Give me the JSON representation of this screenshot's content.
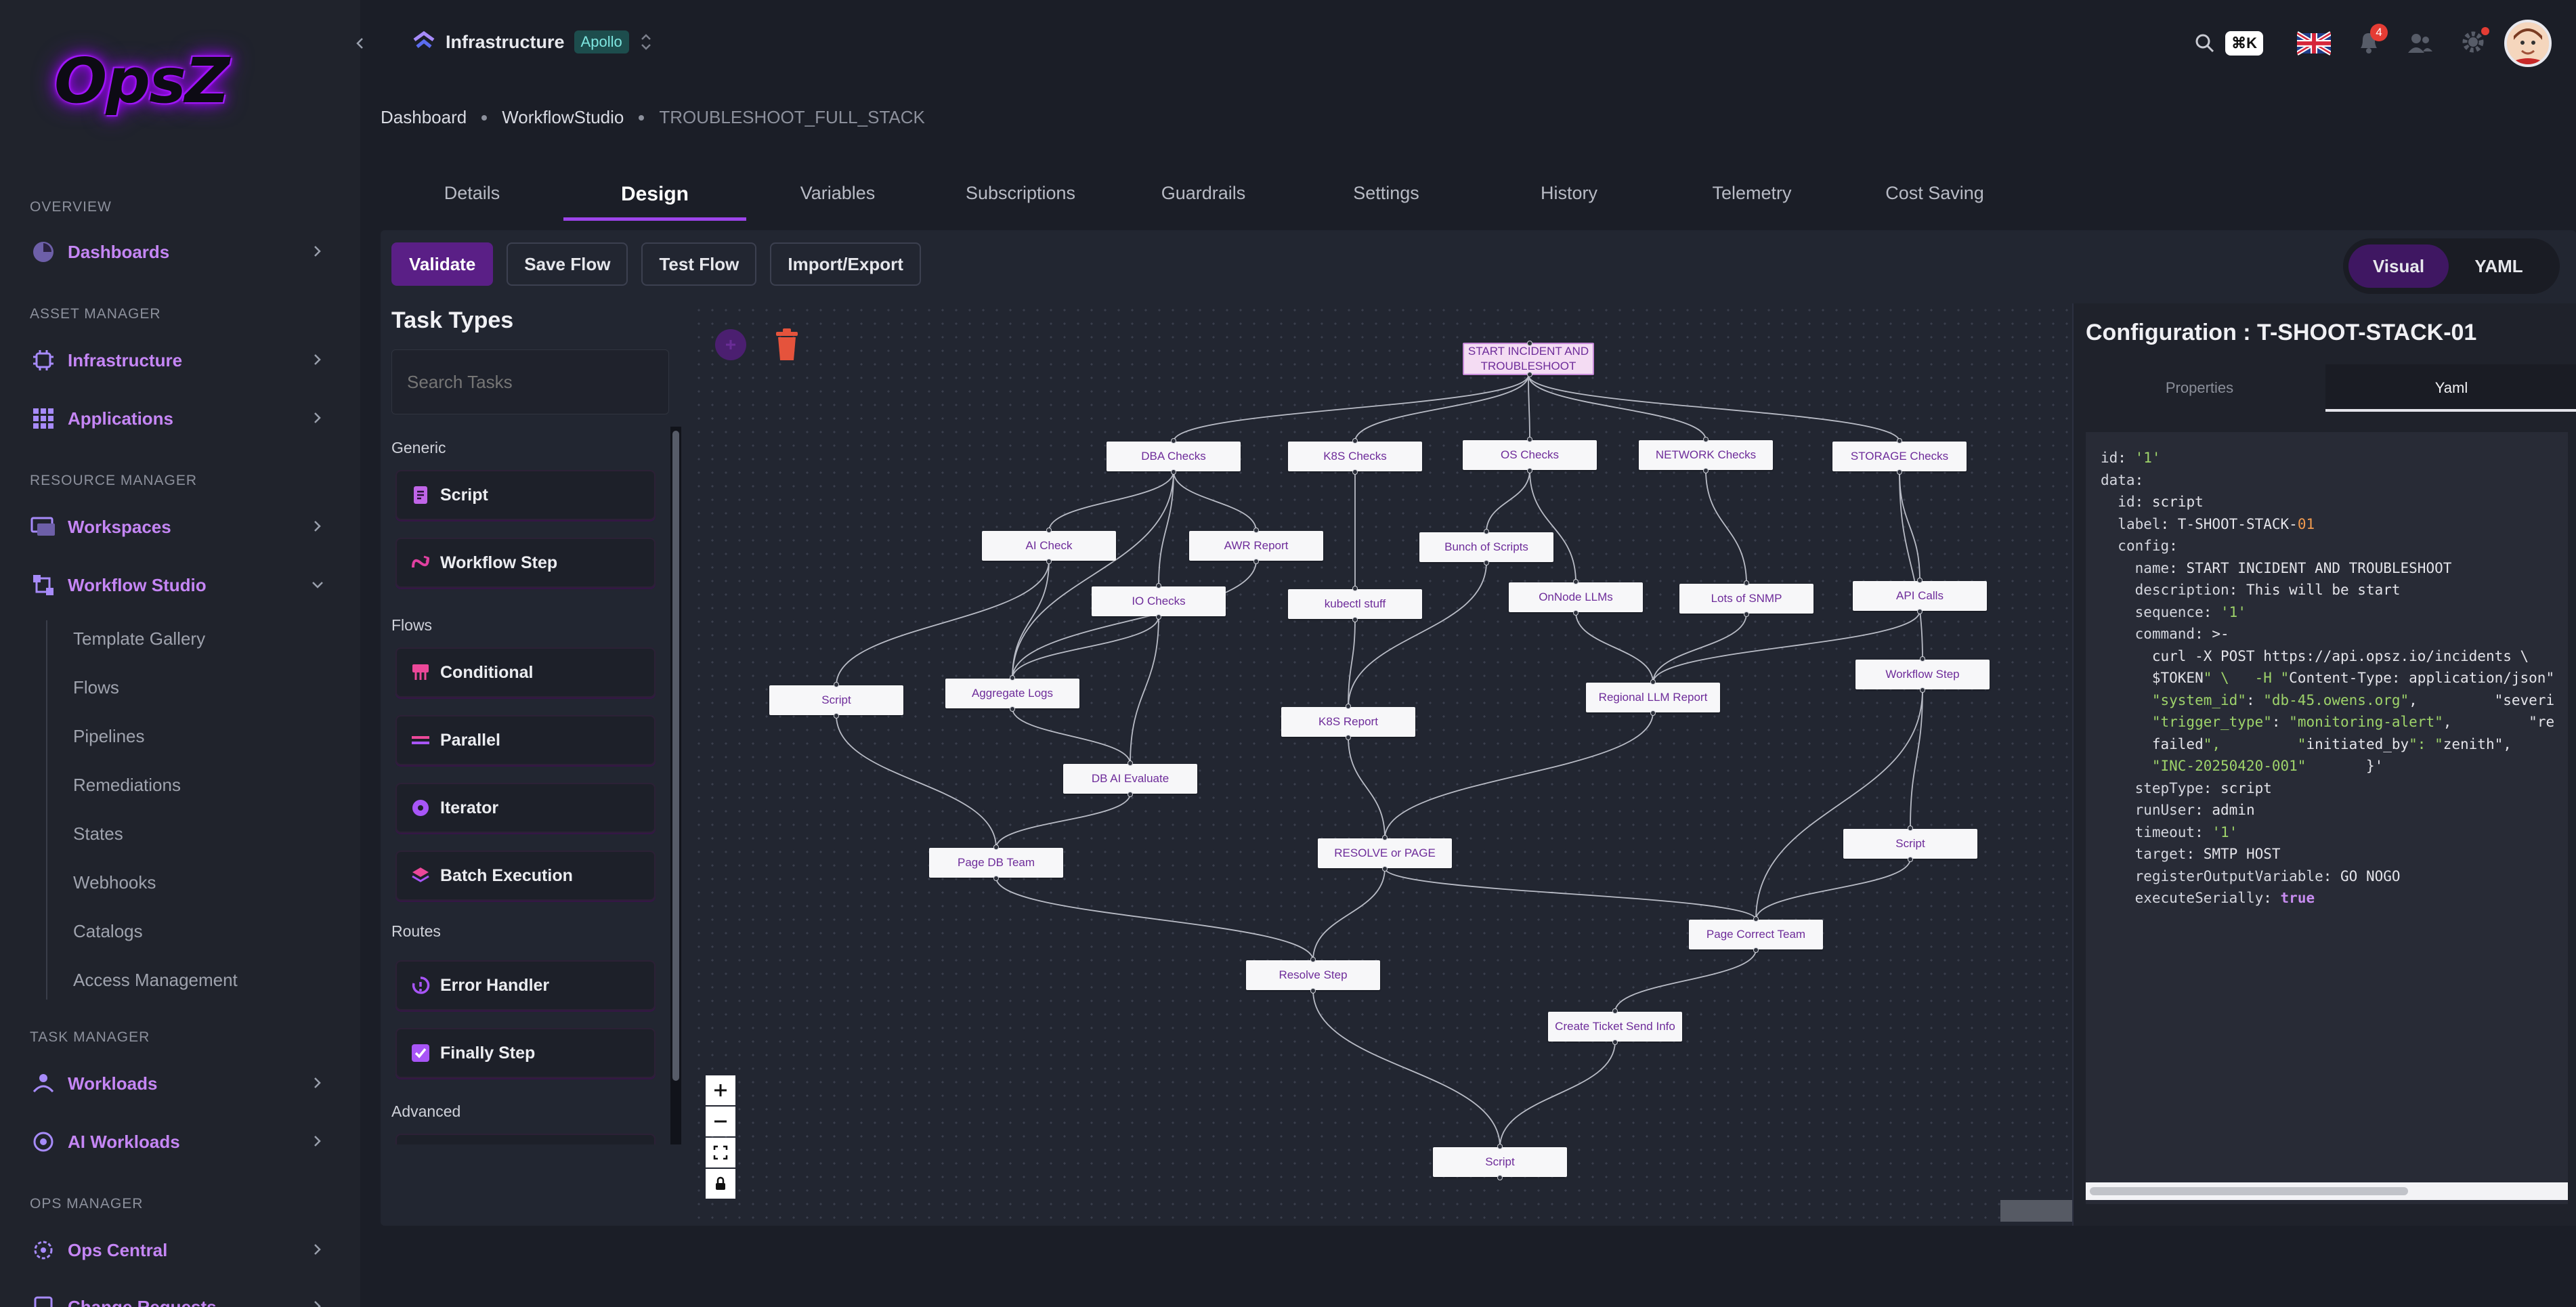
{
  "brand": {
    "logo_text": "OpsZ"
  },
  "sidebar": {
    "sections": [
      {
        "label": "OVERVIEW"
      },
      {
        "label": "ASSET MANAGER"
      },
      {
        "label": "RESOURCE MANAGER"
      },
      {
        "label": "TASK MANAGER"
      },
      {
        "label": "OPS MANAGER"
      }
    ],
    "items": [
      {
        "label": "Dashboards",
        "icon": "dashboard-icon"
      },
      {
        "label": "Infrastructure",
        "icon": "infrastructure-icon"
      },
      {
        "label": "Applications",
        "icon": "grid-icon"
      },
      {
        "label": "Workspaces",
        "icon": "workspaces-icon"
      },
      {
        "label": "Workflow Studio",
        "icon": "workflow-icon"
      },
      {
        "label": "Workloads",
        "icon": "workloads-icon"
      },
      {
        "label": "AI Workloads",
        "icon": "ai-workloads-icon"
      },
      {
        "label": "Ops Central",
        "icon": "ops-central-icon"
      },
      {
        "label": "Change Requests",
        "icon": "change-requests-icon"
      }
    ],
    "workflow_sub": [
      "Template Gallery",
      "Flows",
      "Pipelines",
      "Remediations",
      "States",
      "Webhooks",
      "Catalogs",
      "Access Management"
    ]
  },
  "topbar": {
    "workspace_name": "Infrastructure",
    "workspace_tag": "Apollo",
    "search_shortcut": "⌘K",
    "notification_count": "4"
  },
  "breadcrumb": {
    "items": [
      "Dashboard",
      "WorkflowStudio",
      "TROUBLESHOOT_FULL_STACK"
    ]
  },
  "tabs": [
    "Details",
    "Design",
    "Variables",
    "Subscriptions",
    "Guardrails",
    "Settings",
    "History",
    "Telemetry",
    "Cost Saving"
  ],
  "toolbar": {
    "validate": "Validate",
    "save_flow": "Save Flow",
    "test_flow": "Test Flow",
    "import_export": "Import/Export"
  },
  "view_toggle": {
    "visual": "Visual",
    "yaml": "YAML"
  },
  "task_types": {
    "title": "Task Types",
    "search_placeholder": "Search Tasks",
    "groups": [
      {
        "label": "Generic"
      },
      {
        "label": "Flows"
      },
      {
        "label": "Routes"
      },
      {
        "label": "Advanced"
      }
    ],
    "items": [
      {
        "label": "Script",
        "color": "#c065e8"
      },
      {
        "label": "Workflow Step",
        "color": "#e040a0"
      },
      {
        "label": "Conditional",
        "color": "#ec4899"
      },
      {
        "label": "Parallel",
        "color": "#ec4899"
      },
      {
        "label": "Iterator",
        "color": "#a855f7"
      },
      {
        "label": "Batch Execution",
        "color": "#ec4899"
      },
      {
        "label": "Error Handler",
        "color": "#a855f7"
      },
      {
        "label": "Finally Step",
        "color": "#a855f7"
      }
    ]
  },
  "flow": {
    "nodes": [
      {
        "id": "start",
        "label": "START INCIDENT AND TROUBLESHOOT"
      },
      {
        "id": "dba",
        "label": "DBA Checks"
      },
      {
        "id": "k8s",
        "label": "K8S Checks"
      },
      {
        "id": "os",
        "label": "OS Checks"
      },
      {
        "id": "net",
        "label": "NETWORK Checks"
      },
      {
        "id": "stor",
        "label": "STORAGE Checks"
      },
      {
        "id": "ai",
        "label": "AI Check"
      },
      {
        "id": "awr",
        "label": "AWR Report"
      },
      {
        "id": "bunch",
        "label": "Bunch of Scripts"
      },
      {
        "id": "io",
        "label": "IO Checks"
      },
      {
        "id": "kubectl",
        "label": "kubectl stuff"
      },
      {
        "id": "onnode",
        "label": "OnNode LLMs"
      },
      {
        "id": "snmp",
        "label": "Lots of SNMP"
      },
      {
        "id": "api",
        "label": "API Calls"
      },
      {
        "id": "script1",
        "label": "Script"
      },
      {
        "id": "agg",
        "label": "Aggregate Logs"
      },
      {
        "id": "wfstep",
        "label": "Workflow Step"
      },
      {
        "id": "k8srep",
        "label": "K8S Report"
      },
      {
        "id": "regional",
        "label": "Regional LLM Report"
      },
      {
        "id": "dbai",
        "label": "DB AI Evaluate"
      },
      {
        "id": "pagedb",
        "label": "Page DB Team"
      },
      {
        "id": "resolvepage",
        "label": "RESOLVE or PAGE"
      },
      {
        "id": "script2",
        "label": "Script"
      },
      {
        "id": "pagecorrect",
        "label": "Page Correct Team"
      },
      {
        "id": "resolvestep",
        "label": "Resolve Step"
      },
      {
        "id": "ticket",
        "label": "Create Ticket Send Info"
      },
      {
        "id": "script3",
        "label": "Script"
      }
    ]
  },
  "config": {
    "title": "Configuration : T-SHOOT-STACK-01",
    "tab_properties": "Properties",
    "tab_yaml": "Yaml",
    "yaml_lines": [
      "id: '1'",
      "data:",
      "  id: script",
      "  label: T-SHOOT-STACK-01",
      "  config:",
      "    name: START INCIDENT AND TROUBLESHOOT",
      "    description: This will be start",
      "    sequence: '1'",
      "    command: >-",
      "      curl -X POST https://api.opsz.io/incidents \\",
      "      $TOKEN\" \\   -H \"Content-Type: application/json\"",
      "      \"system_id\": \"db-45.owens.org\",         \"severi",
      "      \"trigger_type\": \"monitoring-alert\",         \"re",
      "      failed\",         \"initiated_by\": \"zenith\",",
      "      \"INC-20250420-001\"       }'",
      "    stepType: script",
      "    runUser: admin",
      "    timeout: '1'",
      "    target: SMTP HOST",
      "    registerOutputVariable: GO NOGO",
      "    executeSerially: true"
    ]
  }
}
